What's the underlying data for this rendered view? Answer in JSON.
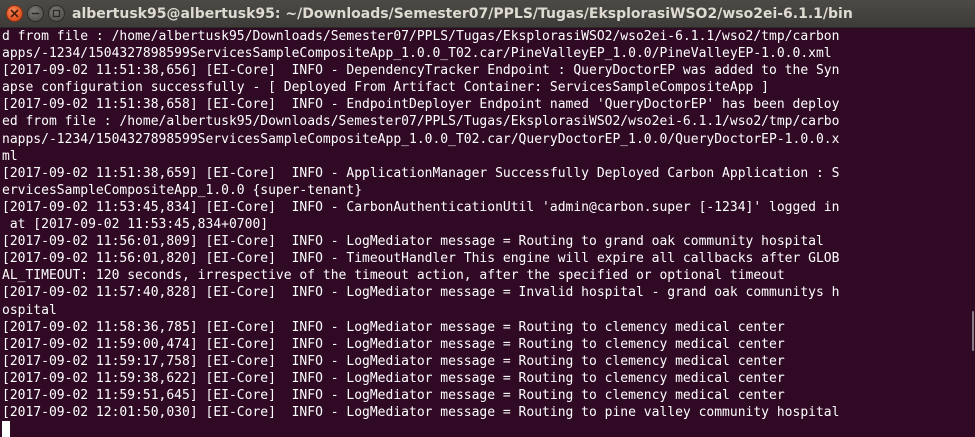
{
  "window": {
    "title": "albertusk95@albertusk95: ~/Downloads/Semester07/PPLS/Tugas/EksplorasiWSO2/wso2ei-6.1.1/bin"
  },
  "colors": {
    "terminal_bg": "#300a24",
    "text": "#ffffff",
    "close_button": "#e55b2a"
  },
  "terminal": {
    "lines": [
      "d from file : /home/albertusk95/Downloads/Semester07/PPLS/Tugas/EksplorasiWSO2/wso2ei-6.1.1/wso2/tmp/carbon",
      "apps/-1234/1504327898599ServicesSampleCompositeApp_1.0.0_T02.car/PineValleyEP_1.0.0/PineValleyEP-1.0.0.xml",
      "[2017-09-02 11:51:38,656] [EI-Core]  INFO - DependencyTracker Endpoint : QueryDoctorEP was added to the Syn",
      "apse configuration successfully - [ Deployed From Artifact Container: ServicesSampleCompositeApp ]",
      "[2017-09-02 11:51:38,658] [EI-Core]  INFO - EndpointDeployer Endpoint named 'QueryDoctorEP' has been deploy",
      "ed from file : /home/albertusk95/Downloads/Semester07/PPLS/Tugas/EksplorasiWSO2/wso2ei-6.1.1/wso2/tmp/carbo",
      "napps/-1234/1504327898599ServicesSampleCompositeApp_1.0.0_T02.car/QueryDoctorEP_1.0.0/QueryDoctorEP-1.0.0.x",
      "ml",
      "[2017-09-02 11:51:38,659] [EI-Core]  INFO - ApplicationManager Successfully Deployed Carbon Application : S",
      "ervicesSampleCompositeApp_1.0.0 {super-tenant}",
      "[2017-09-02 11:53:45,834] [EI-Core]  INFO - CarbonAuthenticationUtil 'admin@carbon.super [-1234]' logged in",
      " at [2017-09-02 11:53:45,834+0700]",
      "[2017-09-02 11:56:01,809] [EI-Core]  INFO - LogMediator message = Routing to grand oak community hospital",
      "[2017-09-02 11:56:01,820] [EI-Core]  INFO - TimeoutHandler This engine will expire all callbacks after GLOB",
      "AL_TIMEOUT: 120 seconds, irrespective of the timeout action, after the specified or optional timeout",
      "[2017-09-02 11:57:40,828] [EI-Core]  INFO - LogMediator message = Invalid hospital - grand oak communitys h",
      "ospital",
      "[2017-09-02 11:58:36,785] [EI-Core]  INFO - LogMediator message = Routing to clemency medical center",
      "[2017-09-02 11:59:00,474] [EI-Core]  INFO - LogMediator message = Routing to clemency medical center",
      "[2017-09-02 11:59:17,758] [EI-Core]  INFO - LogMediator message = Routing to clemency medical center",
      "[2017-09-02 11:59:38,622] [EI-Core]  INFO - LogMediator message = Routing to clemency medical center",
      "[2017-09-02 11:59:51,645] [EI-Core]  INFO - LogMediator message = Routing to clemency medical center",
      "[2017-09-02 12:01:50,030] [EI-Core]  INFO - LogMediator message = Routing to pine valley community hospital"
    ]
  }
}
